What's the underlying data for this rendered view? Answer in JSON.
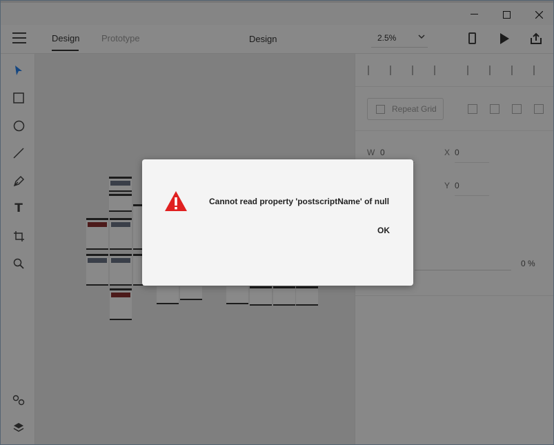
{
  "topbar": {
    "tabs": [
      {
        "label": "Design"
      },
      {
        "label": "Prototype"
      }
    ],
    "document_title": "Design",
    "zoom": "2.5%"
  },
  "toolbar": {
    "tools": [
      "select-icon",
      "rectangle-icon",
      "ellipse-icon",
      "line-icon",
      "pen-icon",
      "text-icon",
      "artboard-icon",
      "zoom-icon",
      "symbols-icon",
      "layers-icon"
    ],
    "text_tool_glyph": "T"
  },
  "properties": {
    "repeat_grid_label": "Repeat Grid",
    "w_label": "W",
    "w_value": "0",
    "x_label": "X",
    "x_value": "0",
    "y_label": "Y",
    "y_value": "0",
    "opacity_value": "0 %"
  },
  "dialog": {
    "message": "Cannot read property 'postscriptName' of null",
    "ok_label": "OK"
  },
  "colors": {
    "accent": "#2680eb",
    "warning": "#e02020"
  }
}
